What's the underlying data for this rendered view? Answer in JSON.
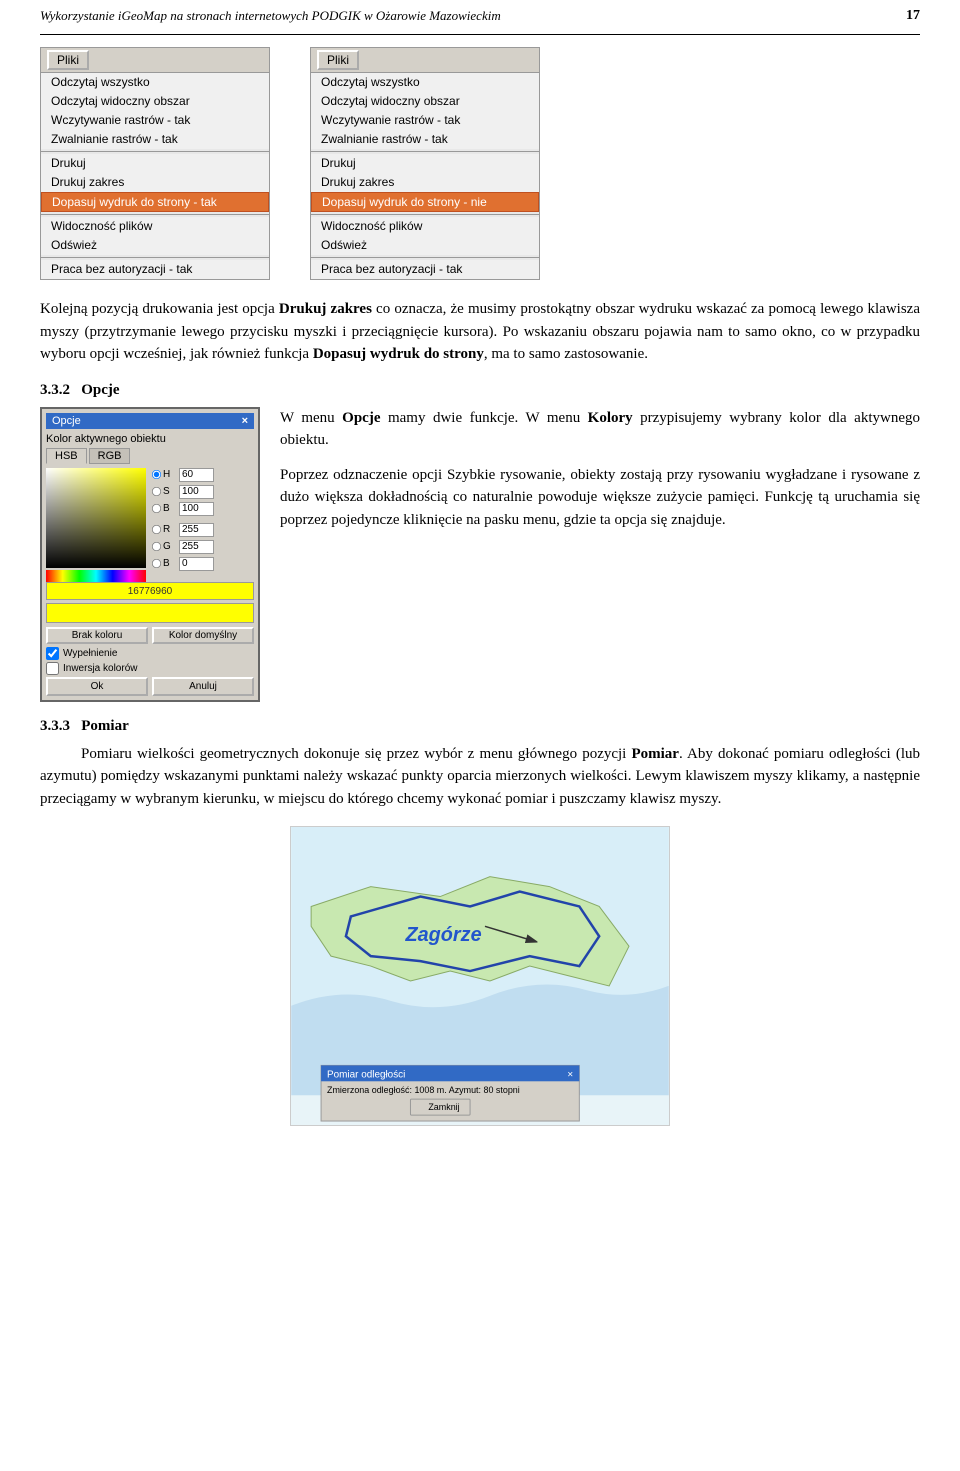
{
  "header": {
    "title": "Wykorzystanie iGeoMap na stronach internetowych PODGIK w Ożarowie Mazowieckim",
    "page_number": "17"
  },
  "menus": [
    {
      "id": "menu-left",
      "title_btn": "Pliki",
      "items": [
        {
          "label": "Odczytaj wszystko",
          "highlighted": false,
          "separator_before": false
        },
        {
          "label": "Odczytaj widoczny obszar",
          "highlighted": false,
          "separator_before": false
        },
        {
          "label": "Wczytywanie rastrów - tak",
          "highlighted": false,
          "separator_before": false
        },
        {
          "label": "Zwalnianie rastrów - tak",
          "highlighted": false,
          "separator_before": false
        },
        {
          "label": "",
          "separator": true
        },
        {
          "label": "Drukuj",
          "highlighted": false,
          "separator_before": false
        },
        {
          "label": "Drukuj zakres",
          "highlighted": false,
          "separator_before": false
        },
        {
          "label": "Dopasuj wydruk do strony - tak",
          "highlighted": true,
          "separator_before": false
        },
        {
          "label": "",
          "separator": true
        },
        {
          "label": "Widoczność plików",
          "highlighted": false,
          "separator_before": false
        },
        {
          "label": "Odśwież",
          "highlighted": false,
          "separator_before": false
        },
        {
          "label": "",
          "separator": true
        },
        {
          "label": "Praca bez autoryzacji - tak",
          "highlighted": false,
          "separator_before": false
        }
      ]
    },
    {
      "id": "menu-right",
      "title_btn": "Pliki",
      "items": [
        {
          "label": "Odczytaj wszystko",
          "highlighted": false,
          "separator_before": false
        },
        {
          "label": "Odczytaj widoczny obszar",
          "highlighted": false,
          "separator_before": false
        },
        {
          "label": "Wczytywanie rastrów - tak",
          "highlighted": false,
          "separator_before": false
        },
        {
          "label": "Zwalnianie rastrów - tak",
          "highlighted": false,
          "separator_before": false
        },
        {
          "label": "",
          "separator": true
        },
        {
          "label": "Drukuj",
          "highlighted": false,
          "separator_before": false
        },
        {
          "label": "Drukuj zakres",
          "highlighted": false,
          "separator_before": false
        },
        {
          "label": "Dopasuj wydruk do strony - nie",
          "highlighted": true,
          "separator_before": false
        },
        {
          "label": "",
          "separator": true
        },
        {
          "label": "Widoczność plików",
          "highlighted": false,
          "separator_before": false
        },
        {
          "label": "Odśwież",
          "highlighted": false,
          "separator_before": false
        },
        {
          "label": "",
          "separator": true
        },
        {
          "label": "Praca bez autoryzacji - tak",
          "highlighted": false,
          "separator_before": false
        }
      ]
    }
  ],
  "paragraph1": "Kolejną pozycją drukowania jest opcja ",
  "paragraph1_bold": "Drukuj zakres",
  "paragraph1_cont": " co oznacza, że musimy prostokątny obszar wydruku wskazać za pomocą lewego klawisza myszy (przytrzymanie lewego przycisku myszki i przeciągnięcie kursora). Po wskazaniu obszaru pojawia nam to samo okno, co w przypadku wyboru opcji wcześniej, jak również funkcja ",
  "paragraph1_bold2": "Dopasuj wydruk do strony",
  "paragraph1_cont2": ", ma to samo zastosowanie.",
  "section332": {
    "number": "3.3.2",
    "title": "Opcje",
    "intro": "W menu ",
    "intro_bold": "Opcje",
    "intro_cont": " mamy dwie funkcje. W menu ",
    "intro_bold2": "Kolory",
    "intro_cont2": " przypisujemy wybrany kolor dla aktywnego obiektu."
  },
  "color_picker": {
    "window_title": "Opcje",
    "close_btn": "×",
    "label": "Kolor aktywnego obiektu",
    "tabs": [
      "HSB",
      "RGB"
    ],
    "active_tab": "HSB",
    "sliders": [
      {
        "radio": true,
        "label": "H",
        "value": "60"
      },
      {
        "radio": false,
        "label": "S",
        "value": "100"
      },
      {
        "radio": false,
        "label": "B",
        "value": "100"
      },
      {
        "radio": false,
        "label": "R",
        "value": "255"
      },
      {
        "radio": false,
        "label": "G",
        "value": "255"
      },
      {
        "radio": false,
        "label": "B2",
        "value": "0"
      }
    ],
    "hex_value": "16776960",
    "btn_no_color": "Brak koloru",
    "btn_default_color": "Kolor domyślny",
    "checkbox_fill": "Wypełnienie",
    "checkbox_invert": "Inwersja kolorów",
    "btn_ok": "Ok",
    "btn_cancel": "Anuluj"
  },
  "color_text": "Poprzez odznaczenie opcji Szybkie rysowanie, obiekty zostają przy rysowaniu wygładzane i rysowane z dużo większa dokładnością co naturalnie powoduje większe zużycie pamięci. Funkcję tą uruchamia się poprzez pojedyncze kliknięcie na pasku menu, gdzie ta opcja się znajduje.",
  "section333": {
    "number": "3.3.3",
    "title": "Pomiar",
    "text1": "Pomiaru wielkości geometrycznych dokonuje się przez wybór z menu głównego pozycji ",
    "text1_bold": "Pomiar",
    "text1_cont": ". Aby dokonać pomiaru odległości (lub azymutu) pomiędzy wskazanymi punktami należy wskazać punkty oparcia mierzonych wielkości. Lewym klawiszem myszy klikamy, a następnie przeciągamy w wybranym kierunku, w miejscu do którego chcemy wykonać pomiar i puszczamy klawisz myszy."
  },
  "map": {
    "zagórze_label": "Zagórze",
    "measurement_title": "Pomiar odległości",
    "measurement_close": "×",
    "measurement_text": "Zmierzona odległość: 1008 m. Azymut: 80 stopni",
    "close_btn_label": "Zamknij"
  }
}
